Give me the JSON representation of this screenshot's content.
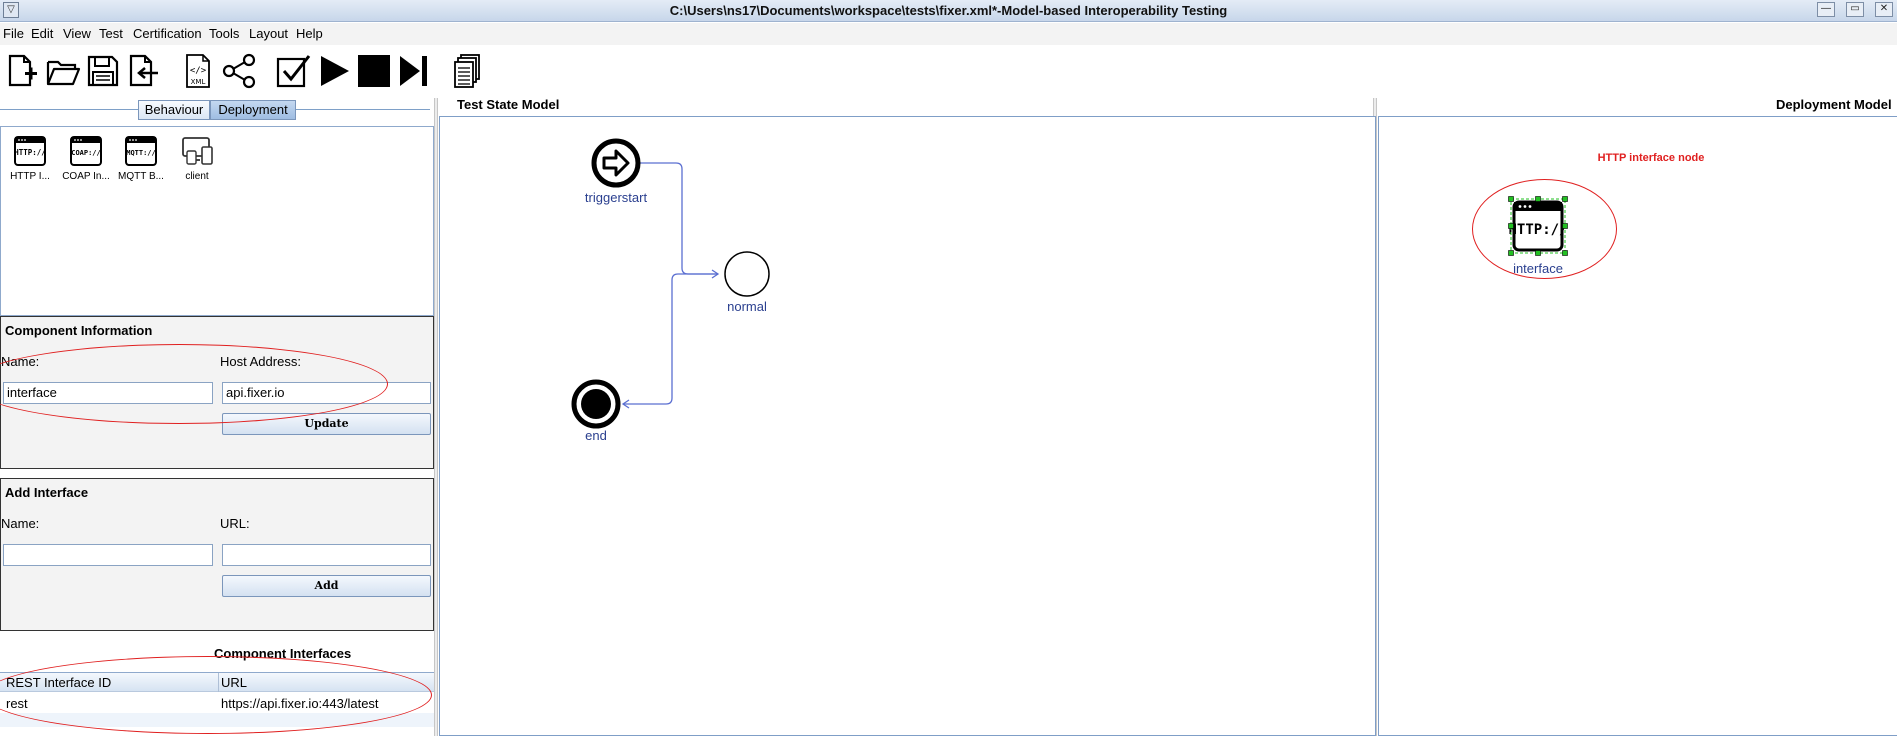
{
  "window": {
    "title": "C:\\Users\\ns17\\Documents\\workspace\\tests\\fixer.xml*-Model-based Interoperability Testing",
    "sysmenu_glyph": "▽",
    "controls": [
      "minimize-icon",
      "maximize-icon",
      "close-icon"
    ]
  },
  "menu": {
    "file": "File",
    "edit": "Edit",
    "view": "View",
    "test": "Test",
    "certification": "Certification",
    "tools": "Tools",
    "layout": "Layout",
    "help": "Help"
  },
  "toolbar": {
    "icons": [
      "new-file-icon",
      "open-folder-icon",
      "save-icon",
      "export-icon",
      "xml-icon",
      "share-graph-icon",
      "check-icon",
      "play-icon",
      "stop-icon",
      "step-forward-icon",
      "documents-icon"
    ],
    "xml_label": "XML"
  },
  "view_toggle": {
    "behaviour": "Behaviour",
    "deployment": "Deployment",
    "active": "Deployment"
  },
  "palette": {
    "items": [
      {
        "icon": "http-interface-icon",
        "label": "HTTP I...",
        "glyph": "HTTP://"
      },
      {
        "icon": "coap-interface-icon",
        "label": "COAP In...",
        "glyph": "COAP://"
      },
      {
        "icon": "mqtt-broker-icon",
        "label": "MQTT B...",
        "glyph": "MQTT://"
      },
      {
        "icon": "client-devices-icon",
        "label": "client",
        "glyph": ""
      }
    ]
  },
  "component_information": {
    "heading": "Component Information",
    "name_label": "Name:",
    "host_label": "Host Address:",
    "name_value": "interface",
    "host_value": "api.fixer.io",
    "update_button": "Update"
  },
  "add_interface": {
    "heading": "Add Interface",
    "name_label": "Name:",
    "url_label": "URL:",
    "name_value": "",
    "url_value": "",
    "add_button": "Add"
  },
  "component_interfaces": {
    "heading": "Component Interfaces",
    "columns": [
      "REST Interface ID",
      "URL"
    ],
    "rows": [
      [
        "rest",
        "https://api.fixer.io:443/latest"
      ]
    ]
  },
  "test_state_model": {
    "title": "Test State Model",
    "nodes": {
      "triggerstart": "triggerstart",
      "normal": "normal",
      "end": "end"
    },
    "edge_color": "#5b6fd1",
    "label_color": "#2a3f8f"
  },
  "deployment_model": {
    "title": "Deployment Model",
    "annotation": "HTTP interface node",
    "node_label": "interface",
    "node_glyph": "HTTP://",
    "annotation_color": "#e02020",
    "selection_handle_color": "#22c022"
  }
}
